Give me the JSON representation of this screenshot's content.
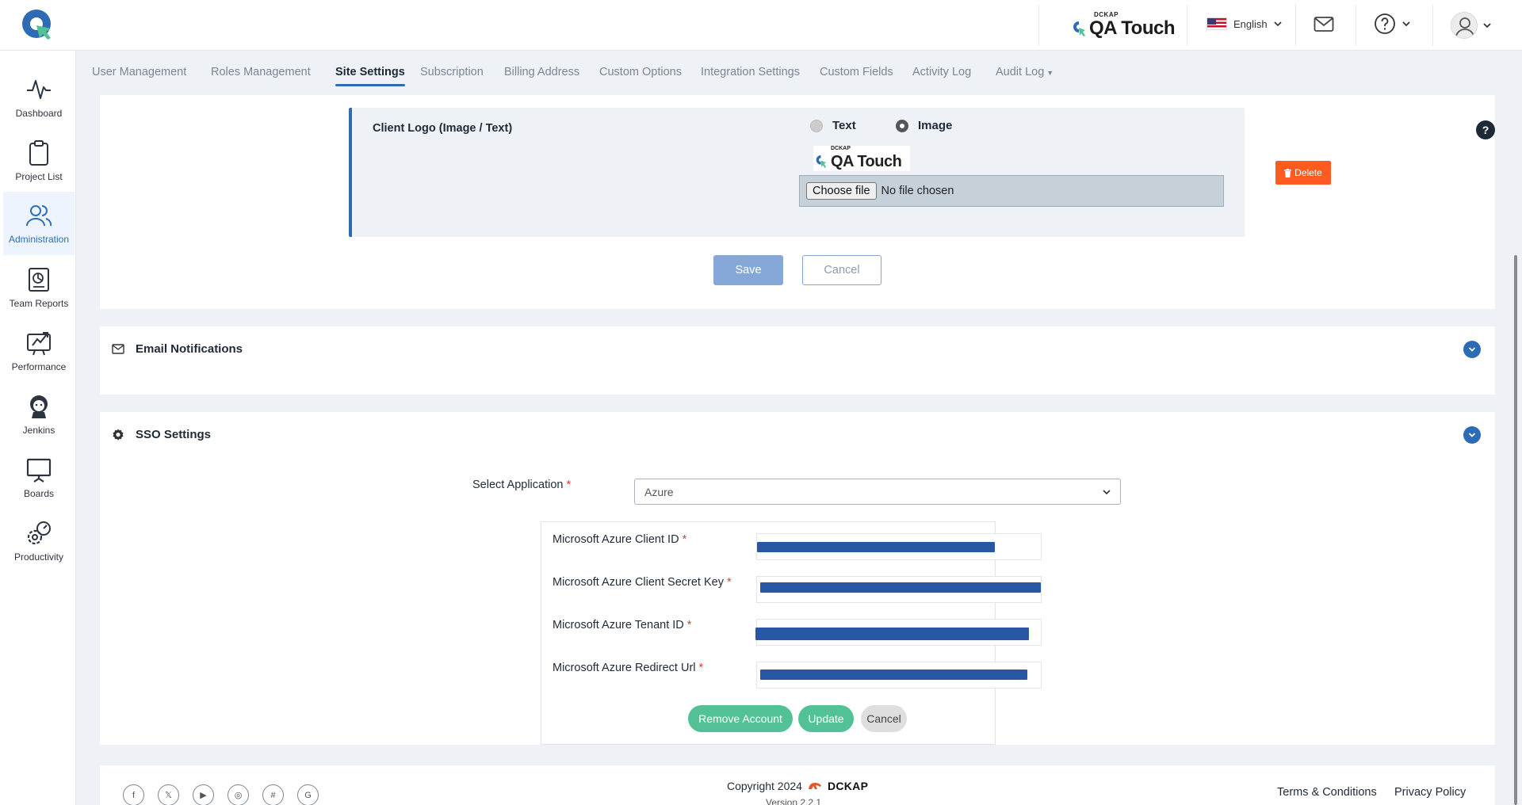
{
  "header": {
    "brand_small": "DCKAP",
    "brand_name": "QA Touch",
    "language": "English"
  },
  "sidebar": {
    "items": [
      {
        "label": "Dashboard",
        "icon": "pulse-icon"
      },
      {
        "label": "Project List",
        "icon": "clipboard-icon"
      },
      {
        "label": "Administration",
        "icon": "users-icon"
      },
      {
        "label": "Team Reports",
        "icon": "report-icon"
      },
      {
        "label": "Performance",
        "icon": "performance-icon"
      },
      {
        "label": "Jenkins",
        "icon": "jenkins-icon"
      },
      {
        "label": "Boards",
        "icon": "board-icon"
      },
      {
        "label": "Productivity",
        "icon": "productivity-icon"
      }
    ],
    "active": "Administration"
  },
  "tabs": [
    {
      "label": "User Management"
    },
    {
      "label": "Roles Management"
    },
    {
      "label": "Site Settings"
    },
    {
      "label": "Subscription"
    },
    {
      "label": "Billing Address"
    },
    {
      "label": "Custom Options"
    },
    {
      "label": "Integration Settings"
    },
    {
      "label": "Custom Fields"
    },
    {
      "label": "Activity Log"
    },
    {
      "label": "Audit Log"
    }
  ],
  "active_tab": "Site Settings",
  "client_logo": {
    "title": "Client Logo (Image / Text)",
    "option_text": "Text",
    "option_image": "Image",
    "selected": "Image",
    "help": "?",
    "preview_small": "DCKAP",
    "preview_text": "QA Touch",
    "delete_label": "Delete",
    "choose_file_label": "Choose file",
    "file_status": "No file chosen",
    "save_label": "Save",
    "cancel_label": "Cancel"
  },
  "email_notifications": {
    "title": "Email Notifications"
  },
  "sso": {
    "title": "SSO Settings",
    "select_label": "Select Application",
    "required_mark": "*",
    "selected_app": "Azure",
    "fields": [
      {
        "label": "Microsoft Azure Client ID"
      },
      {
        "label": "Microsoft Azure Client Secret Key"
      },
      {
        "label": "Microsoft Azure Tenant ID"
      },
      {
        "label": "Microsoft Azure Redirect Url"
      }
    ],
    "remove_label": "Remove Account",
    "update_label": "Update",
    "cancel_label": "Cancel"
  },
  "footer": {
    "copyright": "Copyright 2024",
    "company": "DCKAP",
    "version": "Version 2.2.1",
    "terms": "Terms & Conditions",
    "privacy": "Privacy Policy"
  },
  "colors": {
    "accent": "#2d6cb5",
    "delete": "#ff5a1f",
    "green": "#52c296",
    "redaction": "#2857a4"
  }
}
